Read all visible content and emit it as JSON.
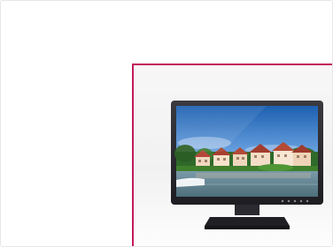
{
  "product": {
    "image_icon": "monitor-icon",
    "accent_color": "#c21a5c"
  }
}
